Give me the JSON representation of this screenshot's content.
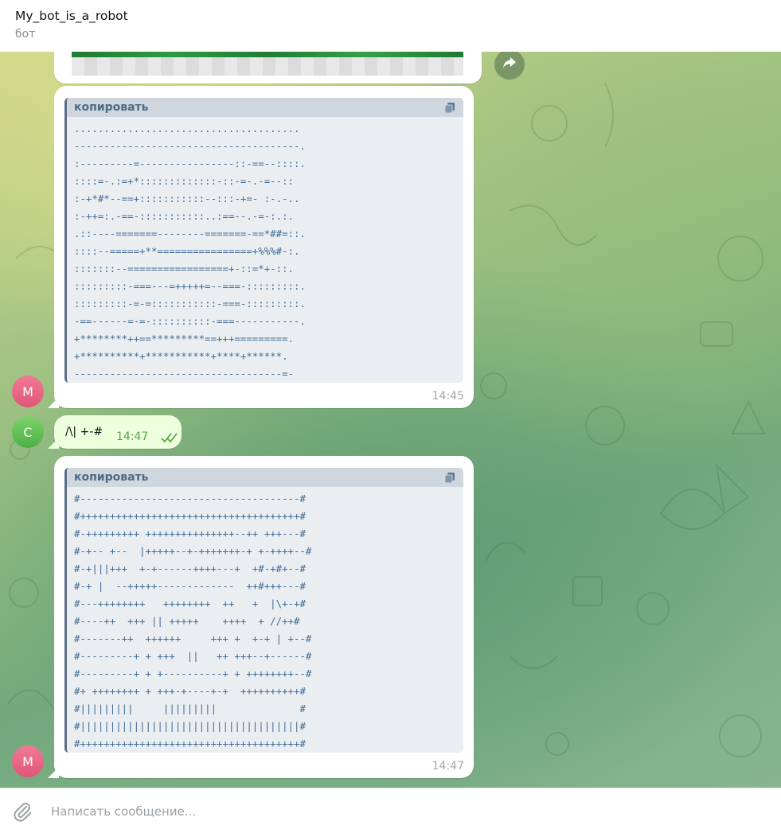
{
  "header": {
    "title": "My_bot_is_a_robot",
    "subtitle": "бот"
  },
  "messages": [
    {
      "copy_label": "копировать",
      "time": "14:45",
      "avatar_letter": "M",
      "lines": [
        "......................................",
        "--------------------------------------.",
        ":---------=----------------::-==--::::.",
        "::::=-.:=+*:::::::::::::-::-=-.-=--::",
        ":-+*#*--==+:::::::::::--:::-+=- :-.-..",
        ":-++=:.-==-:::::::::::..:==--.-=-:.:.",
        ".::----=======--------=======-==*##=::.",
        "::::--=====+**================+%%%#-:.",
        ":::::::--=================+-::=*+-::.",
        ":::::::::-===---=+++++=--===-:::::::::.",
        ":::::::::-=-=:::::::::::-===-:::::::::.",
        "-==------=-=-::::::::::-===-----------.",
        "+********++==*********==+++=========.",
        "+**********+***********+****+******.",
        "-----------------------------------=-"
      ]
    },
    {
      "text": "/\\| +-#",
      "time": "14:47",
      "avatar_letter": "C"
    },
    {
      "copy_label": "копировать",
      "time": "14:47",
      "avatar_letter": "M",
      "lines": [
        "#-------------------------------------#",
        "#+++++++++++++++++++++++++++++++++++++#",
        "#-+++++++++ +++++++++++++++--++ +++---#",
        "#-+-- +--  |+++++--+-+++++++-+ +-++++--#",
        "#-+|||+++  +-+------++++---+  +#-+#+--#",
        "#-+ |  --+++++-------------  ++#+++---#",
        "#---++++++++   ++++++++  ++   +  |\\+-+#",
        "#----++  +++ || +++++    ++++  + //++#",
        "#-------++  ++++++     +++ +  +-+ | +--#",
        "#---------+ + +++  ||   ++ +++--+------#",
        "#---------+ + +----------+ + ++++++++--#",
        "#+ ++++++++ + +++-+----+-+  ++++++++++#",
        "#|||||||||     |||||||||              #",
        "#|||||||||||||||||||||||||||||||||||||#",
        "#+++++++++++++++++++++++++++++++++++++#"
      ]
    }
  ],
  "composer": {
    "placeholder": "Написать сообщение..."
  },
  "icons": {
    "forward": "forward-arrow-icon",
    "copy": "copy-icon",
    "read": "double-check-icon",
    "attach": "paperclip-icon"
  },
  "colors": {
    "outgoing_bubble": "#eeffde",
    "code_text": "#3f6a94",
    "code_header": "#cfd6dd",
    "avatar_m": "#e0557a",
    "avatar_c": "#4cb047"
  }
}
